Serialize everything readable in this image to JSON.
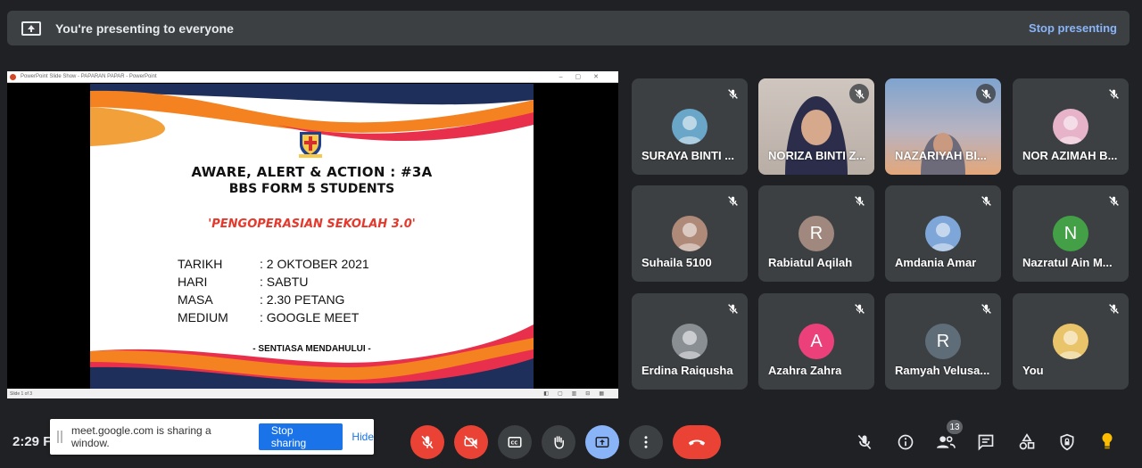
{
  "banner": {
    "title": "You're presenting to everyone",
    "stop_label": "Stop presenting"
  },
  "presentation": {
    "window_title": "PowerPoint Slide Show  -  PAPARAN PAPAR  -  PowerPoint",
    "status_left": "Slide 1 of 3",
    "slide": {
      "title_line1": "AWARE, ALERT & ACTION : #3A",
      "title_line2": "BBS FORM 5 STUDENTS",
      "subtitle": "'PENGOPERASIAN SEKOLAH 3.0'",
      "details": [
        {
          "label": "TARIKH",
          "value": ": 2 OKTOBER 2021"
        },
        {
          "label": "HARI",
          "value": ": SABTU"
        },
        {
          "label": "MASA",
          "value": ": 2.30 PETANG"
        },
        {
          "label": "MEDIUM",
          "value": ": GOOGLE MEET"
        }
      ],
      "footer": "- SENTIASA MENDAHULUI -"
    }
  },
  "participants": [
    {
      "name": "SURAYA BINTI ...",
      "muted": true,
      "avatar_type": "photo",
      "avatar_color": "#6aa6c8"
    },
    {
      "name": "NORIZA BINTI Z...",
      "muted": true,
      "avatar_type": "video",
      "avatar_color": "#c9bfb8"
    },
    {
      "name": "NAZARIYAH BI...",
      "muted": true,
      "avatar_type": "video",
      "avatar_color": "#d9a07a"
    },
    {
      "name": "NOR AZIMAH B...",
      "muted": true,
      "avatar_type": "photo",
      "avatar_color": "#e7b3c9"
    },
    {
      "name": "Suhaila 5100",
      "muted": true,
      "avatar_type": "photo",
      "avatar_color": "#b08a78"
    },
    {
      "name": "Rabiatul Aqilah",
      "muted": true,
      "avatar_type": "letter",
      "letter": "R",
      "avatar_color": "#a1887f"
    },
    {
      "name": "Amdania Amar",
      "muted": true,
      "avatar_type": "photo",
      "avatar_color": "#7fa6d8"
    },
    {
      "name": "Nazratul Ain M...",
      "muted": true,
      "avatar_type": "letter",
      "letter": "N",
      "avatar_color": "#43a047"
    },
    {
      "name": "Erdina Raiqusha",
      "muted": true,
      "avatar_type": "photo",
      "avatar_color": "#8a8f94"
    },
    {
      "name": "Azahra Zahra",
      "muted": true,
      "avatar_type": "letter",
      "letter": "A",
      "avatar_color": "#ec407a"
    },
    {
      "name": "Ramyah Velusa...",
      "muted": true,
      "avatar_type": "letter",
      "letter": "R",
      "avatar_color": "#5f6d78"
    },
    {
      "name": "You",
      "muted": true,
      "avatar_type": "photo",
      "avatar_color": "#e9c46a"
    }
  ],
  "bottom": {
    "clock": "2:29 F",
    "share_notice": {
      "message": "meet.google.com is sharing a window.",
      "stop_label": "Stop sharing",
      "hide_label": "Hide"
    },
    "people_count": "13"
  },
  "colors": {
    "background": "#202124",
    "tile": "#3c4043",
    "danger": "#ea4335",
    "accent": "#8ab4f8"
  }
}
